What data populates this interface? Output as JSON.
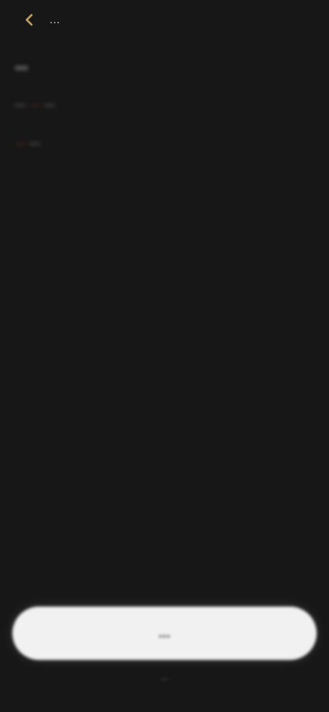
{
  "topbar": {
    "back_icon": "back-arrow-icon",
    "title": "..."
  },
  "content": {
    "heading": "...",
    "paragraph_1_before": "...",
    "paragraph_1_link": "...",
    "paragraph_1_after": "...",
    "paragraph_2_link": "...",
    "paragraph_2_after": "..."
  },
  "bottom": {
    "primary_button": "...",
    "footer_text": "..."
  },
  "colors": {
    "background": "#171717",
    "text": "#d8d8d8",
    "link": "#b83a3a",
    "button": "#f1f1f1"
  }
}
